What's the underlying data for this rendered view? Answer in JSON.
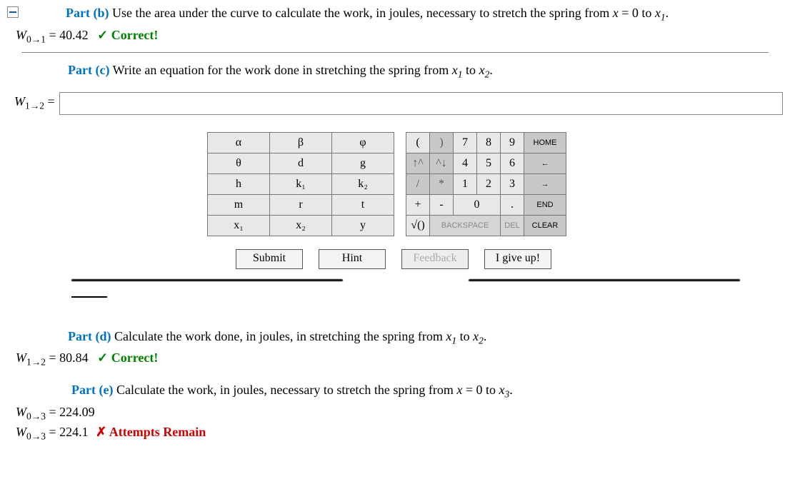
{
  "partB": {
    "label": "Part (b)",
    "prompt_pre": "  Use the area under the curve to calculate the work, in joules, necessary to stretch the spring from ",
    "prompt_mid": "x",
    "prompt_eq": " = 0 to ",
    "prompt_var": "x",
    "prompt_sub": "1",
    "answer_lhs_W": "W",
    "answer_lhs_sub": "0→1",
    "answer_val": " = 40.42",
    "correct": "Correct!"
  },
  "partC": {
    "label": "Part (c)",
    "prompt_pre": "  Write an equation for the work done in stretching the spring from ",
    "v1": "x",
    "s1": "1",
    "mid": " to ",
    "v2": "x",
    "s2": "2",
    "lhs_W": "W",
    "lhs_sub": "1→2",
    "lhs_eq": " ="
  },
  "keypad": {
    "vars": [
      [
        "α",
        "β",
        "φ"
      ],
      [
        "θ",
        "d",
        "g"
      ],
      [
        "h",
        "k₁",
        "k₂"
      ],
      [
        "m",
        "r",
        "t"
      ],
      [
        "x₁",
        "x₂",
        "y"
      ]
    ],
    "nums": {
      "r0": {
        "lp": "(",
        "rp": ")",
        "n7": "7",
        "n8": "8",
        "n9": "9",
        "home": "HOME"
      },
      "r1": {
        "up": "↑^",
        "dn": "^↓",
        "n4": "4",
        "n5": "5",
        "n6": "6",
        "left": "←"
      },
      "r2": {
        "sl": "/",
        "st": "*",
        "n1": "1",
        "n2": "2",
        "n3": "3",
        "right": "→"
      },
      "r3": {
        "pl": "+",
        "mi": "-",
        "n0": "0",
        "dot": ".",
        "end": "END"
      },
      "r4": {
        "sq": "√()",
        "bs": "BACKSPACE",
        "del": "DEL",
        "clr": "CLEAR"
      }
    }
  },
  "buttons": {
    "submit": "Submit",
    "hint": "Hint",
    "feedback": "Feedback",
    "giveup": "I give up!"
  },
  "partD": {
    "label": "Part (d)",
    "prompt_pre": "  Calculate the work done, in joules, in stretching the spring from ",
    "v1": "x",
    "s1": "1",
    "mid": " to ",
    "v2": "x",
    "s2": "2",
    "ans_W": "W",
    "ans_sub": "1→2",
    "ans_val": " = 80.84",
    "correct": "Correct!"
  },
  "partE": {
    "label": "Part (e)",
    "prompt_pre": "  Calculate the work, in joules, necessary to stretch the spring from ",
    "xm": "x",
    "eq": " = 0 to ",
    "xv": "x",
    "xs": "3",
    "a1_W": "W",
    "a1_sub": "0→3",
    "a1_val": " = 224.09",
    "a2_W": "W",
    "a2_sub": "0→3",
    "a2_val": " = 224.1",
    "attempts": "Attempts Remain"
  }
}
